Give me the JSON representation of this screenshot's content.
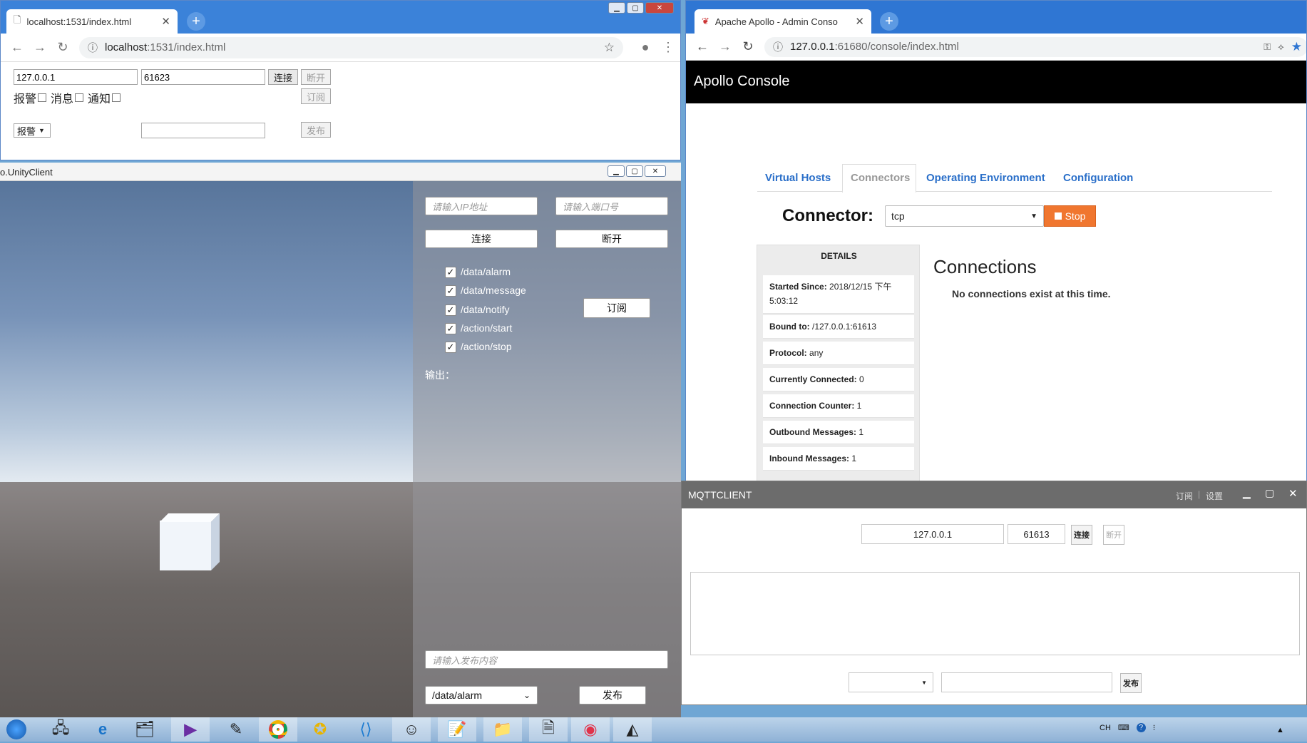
{
  "browser1": {
    "tab_title": "localhost:1531/index.html",
    "url_host": "localhost",
    "url_rest": ":1531/index.html",
    "ip_value": "127.0.0.1",
    "port_value": "61623",
    "connect_label": "连接",
    "disconnect_label": "断开",
    "checkbox_alarm": "报警",
    "checkbox_message": "消息",
    "checkbox_notify": "通知",
    "subscribe_label": "订阅",
    "topic_select": "报警",
    "publish_label": "发布"
  },
  "unity": {
    "window_title": "o.UnityClient",
    "ip_placeholder": "请输入IP地址",
    "port_placeholder": "请输入端口号",
    "connect_label": "连接",
    "disconnect_label": "断开",
    "topics": [
      "/data/alarm",
      "/data/message",
      "/data/notify",
      "/action/start",
      "/action/stop"
    ],
    "subscribe_label": "订阅",
    "output_label": "输出：",
    "publish_placeholder": "请输入发布内容",
    "topic_select": "/data/alarm",
    "publish_label": "发布"
  },
  "browser2": {
    "tab_title": "Apache Apollo - Admin Conso",
    "url_host": "127.0.0.1",
    "url_rest": ":61680/console/index.html",
    "header_title": "Apollo Console",
    "tabs": [
      "Virtual Hosts",
      "Connectors",
      "Operating Environment",
      "Configuration"
    ],
    "connector_label": "Connector:",
    "connector_value": "tcp",
    "stop_label": "Stop",
    "details_title": "DETAILS",
    "details": [
      {
        "k": "Started Since:",
        "v": "2018/12/15 下午 5:03:12"
      },
      {
        "k": "Bound to:",
        "v": "/127.0.0.1:61613"
      },
      {
        "k": "Protocol:",
        "v": "any"
      },
      {
        "k": "Currently Connected:",
        "v": "0"
      },
      {
        "k": "Connection Counter:",
        "v": "1"
      },
      {
        "k": "Outbound Messages:",
        "v": "1"
      },
      {
        "k": "Inbound Messages:",
        "v": "1"
      }
    ],
    "connections_title": "Connections",
    "connections_empty": "No connections exist at this time."
  },
  "mqtt": {
    "window_title": "MQTTCLIENT",
    "menu_subscribe": "订阅",
    "menu_settings": "设置",
    "ip_value": "127.0.0.1",
    "port_value": "61613",
    "connect_label": "连接",
    "disconnect_label": "断开",
    "publish_label": "发布"
  },
  "taskbar": {
    "lang": "CH"
  }
}
